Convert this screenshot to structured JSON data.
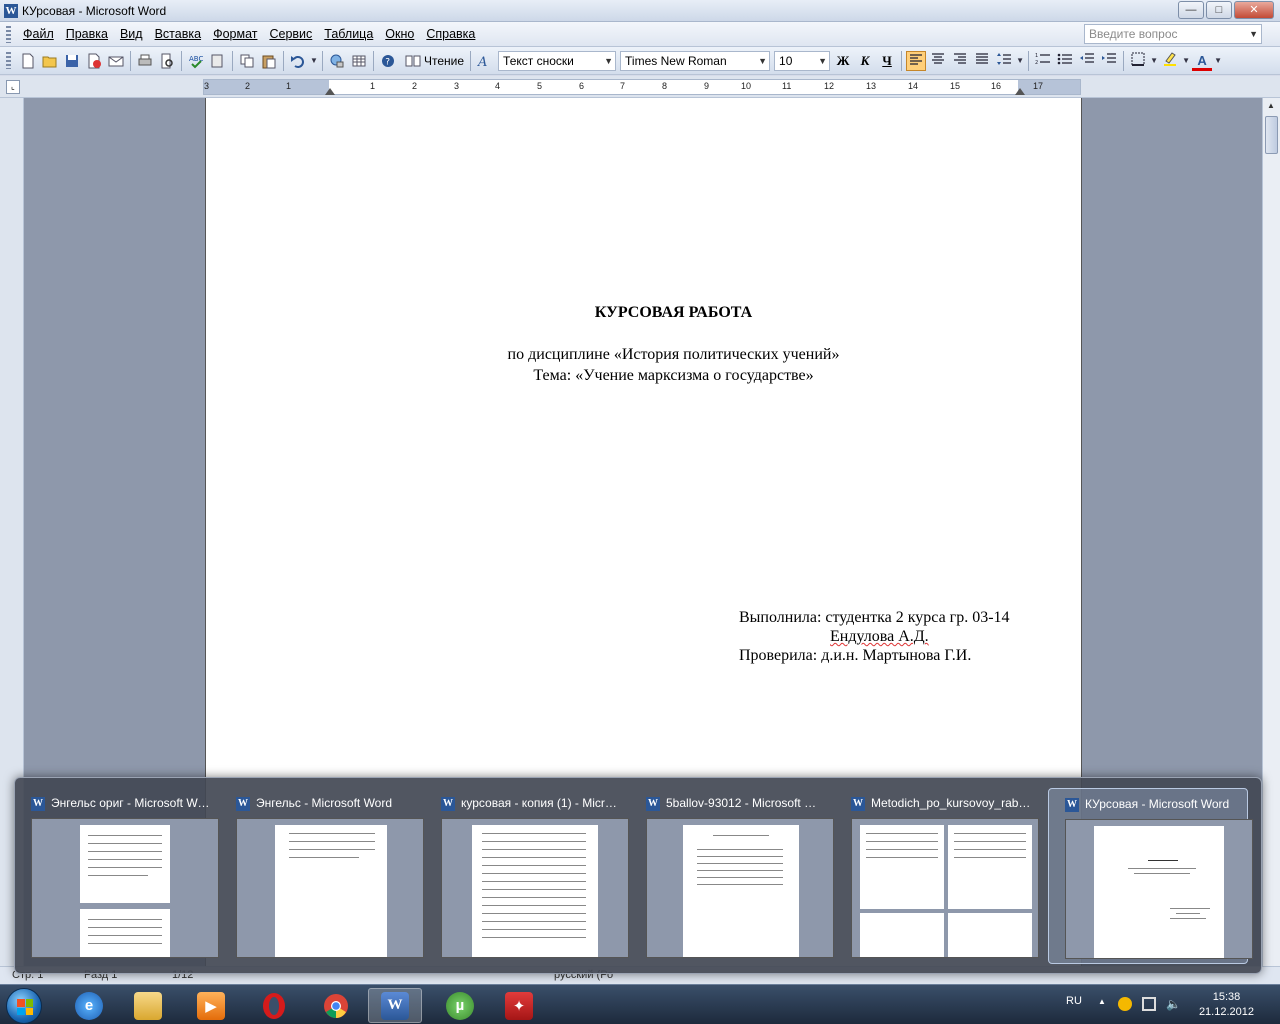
{
  "window": {
    "title": "КУрсовая - Microsoft Word",
    "app_icon": "word-icon",
    "controls": [
      "minimize",
      "maximize",
      "close"
    ]
  },
  "menu": {
    "items": [
      "Файл",
      "Правка",
      "Вид",
      "Вставка",
      "Формат",
      "Сервис",
      "Таблица",
      "Окно",
      "Справка"
    ],
    "ask_placeholder": "Введите вопрос"
  },
  "toolbar": {
    "read_label": "Чтение",
    "style": "Текст сноски",
    "font": "Times New Roman",
    "size": "10",
    "bold": "Ж",
    "italic": "К",
    "underline": "Ч",
    "text_color": "A"
  },
  "ruler": {
    "numbers": [
      "3",
      "2",
      "1",
      "1",
      "2",
      "3",
      "4",
      "5",
      "6",
      "7",
      "8",
      "9",
      "10",
      "11",
      "12",
      "13",
      "14",
      "15",
      "16",
      "17"
    ]
  },
  "document": {
    "heading": "КУРСОВАЯ РАБОТА",
    "discipline": "по дисциплине «История политических учений»",
    "topic": "Тема: «Учение марксизма о государстве»",
    "performer": "Выполнила: студентка 2 курса гр. 03-14",
    "student_name": "Ендулова А.Д.",
    "checker": "Проверила: д.и.н. Мартынова Г.И."
  },
  "statusbar": {
    "page": "Стр. 1",
    "section": "Разд 1",
    "pages": "1/12",
    "language": "русский (Ро"
  },
  "thumbnails": [
    {
      "title": "Энгельс ориг - Microsoft Wo..."
    },
    {
      "title": "Энгельс - Microsoft Word"
    },
    {
      "title": "курсовая - копия (1) - Micro..."
    },
    {
      "title": "5ballov-93012 - Microsoft Wo..."
    },
    {
      "title": "Metodich_po_kursovoy_rabot..."
    },
    {
      "title": "КУрсовая - Microsoft Word",
      "active": true
    }
  ],
  "taskbar": {
    "apps": [
      "start-icon",
      "ie-icon",
      "explorer-icon",
      "media-player-icon",
      "opera-icon",
      "chrome-icon",
      "word-icon",
      "utorrent-icon",
      "acrobat-icon"
    ],
    "language": "RU",
    "time": "15:38",
    "date": "21.12.2012"
  },
  "colors": {
    "accent": "#2b5797",
    "workspace": "#8e98ab",
    "active_button": "#ffcf7a"
  }
}
